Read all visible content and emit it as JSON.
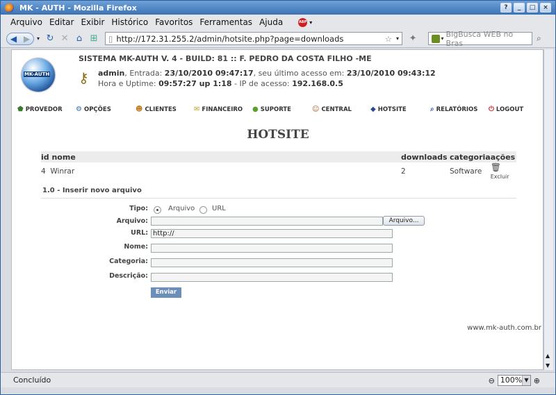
{
  "window": {
    "title": "MK - AUTH - Mozilla Firefox"
  },
  "menubar": [
    "Arquivo",
    "Editar",
    "Exibir",
    "Histórico",
    "Favoritos",
    "Ferramentas",
    "Ajuda"
  ],
  "abp": "ABP",
  "nav": {
    "url": "http://172.31.255.2/admin/hotsite.php?page=downloads",
    "search_placeholder": "BigBusca WEB no Bras"
  },
  "header": {
    "logo_text": "MK-AUTH",
    "system": "SISTEMA MK-AUTH V. 4 - BUILD: 81 :: F. PEDRO DA COSTA FILHO -ME",
    "user": "admin",
    "entrada_label": ", Entrada: ",
    "entrada": "23/10/2010 09:47:17",
    "ultimo_label": ", seu último acesso em: ",
    "ultimo": "23/10/2010 09:43:12",
    "hora_label": "Hora e Uptime: ",
    "uptime": "09:57:27 up 1:18",
    "ip_label": " - IP de acesso: ",
    "ip": "192.168.0.5"
  },
  "menu": [
    {
      "label": "PROVEDOR",
      "icon": "provider-icon"
    },
    {
      "label": "OPÇÕES",
      "icon": "options-icon"
    },
    {
      "label": "CLIENTES",
      "icon": "clients-icon"
    },
    {
      "label": "FINANCEIRO",
      "icon": "finance-icon"
    },
    {
      "label": "SUPORTE",
      "icon": "support-icon"
    },
    {
      "label": "CENTRAL",
      "icon": "central-icon"
    },
    {
      "label": "HOTSITE",
      "icon": "hotsite-icon"
    },
    {
      "label": "RELATÓRIOS",
      "icon": "reports-icon"
    },
    {
      "label": "LOGOUT",
      "icon": "logout-icon"
    }
  ],
  "page_title": "HOTSITE",
  "table": {
    "headers": [
      "id nome",
      "downloads",
      "categoria",
      "ações"
    ],
    "rows": [
      {
        "id": "4",
        "nome": "Winrar",
        "downloads": "2",
        "categoria": "Software",
        "acao": "Excluir"
      }
    ]
  },
  "section": "1.0 - Inserir novo arquivo",
  "form": {
    "tipo_label": "Tipo:",
    "opt_arquivo": "Arquivo",
    "opt_url": "URL",
    "arquivo_label": "Arquivo:",
    "browse": "Arquivo...",
    "url_label": "URL:",
    "url_value": "http://",
    "nome_label": "Nome:",
    "categoria_label": "Categoria:",
    "descricao_label": "Descrição:",
    "submit": "Enviar"
  },
  "footer": "www.mk-auth.com.br",
  "status": {
    "text": "Concluído",
    "zoom": "100%"
  }
}
